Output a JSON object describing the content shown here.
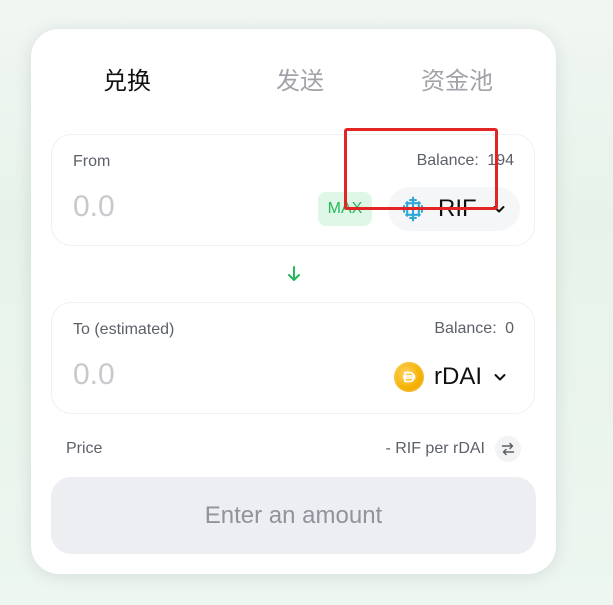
{
  "tabs": [
    {
      "label": "兑换",
      "active": true
    },
    {
      "label": "发送",
      "active": false
    },
    {
      "label": "资金池",
      "active": false
    }
  ],
  "from_panel": {
    "label": "From",
    "balance_label": "Balance:",
    "balance_value": "194",
    "amount_placeholder": "0.0",
    "max_label": "MAX",
    "token": {
      "symbol": "RIF",
      "icon": "rif-token-icon",
      "icon_color": "#2fa8d8"
    }
  },
  "to_panel": {
    "label": "To (estimated)",
    "balance_label": "Balance:",
    "balance_value": "0",
    "amount_placeholder": "0.0",
    "token": {
      "symbol": "rDAI",
      "icon": "rdai-token-icon",
      "icon_color": "#f6b100"
    }
  },
  "swap_direction_icon": "arrow-down-icon",
  "price": {
    "label": "Price",
    "value": "- RIF per rDAI",
    "invert_icon": "swap-horizontal-icon"
  },
  "primary_button": {
    "label": "Enter an amount"
  },
  "colors": {
    "accent_green": "#24b85b",
    "max_bg": "#dff7e6",
    "highlight_red": "#e32424",
    "button_bg": "#edeef1",
    "card_bg": "#ffffff"
  }
}
